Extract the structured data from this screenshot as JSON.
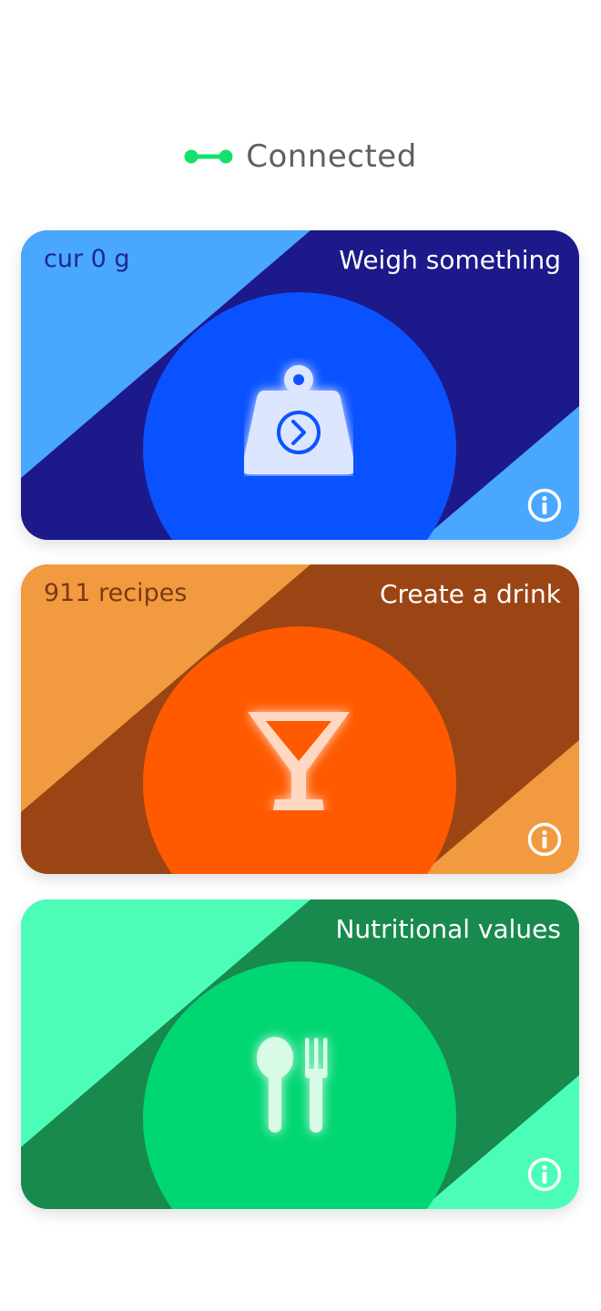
{
  "connection": {
    "status_label": "Connected",
    "status_color": "#14e06b"
  },
  "cards": [
    {
      "left_label": "cur 0 g",
      "title": "Weigh something",
      "icon": "weight-icon",
      "colors": {
        "bg": "#4aa7ff",
        "band": "#1c198a",
        "circle": "#0a52ff",
        "left_text": "#1a2a8c"
      }
    },
    {
      "left_label": "911 recipes",
      "title": "Create a drink",
      "icon": "cocktail-glass-icon",
      "colors": {
        "bg": "#f29a40",
        "band": "#9b4514",
        "circle": "#ff5a00",
        "left_text": "#7a3a12"
      }
    },
    {
      "left_label": "",
      "title": "Nutritional values",
      "icon": "cutlery-icon",
      "colors": {
        "bg": "#4cfdb8",
        "band": "#188a4e",
        "circle": "#00d672",
        "left_text": "#0f6a3a"
      }
    }
  ]
}
